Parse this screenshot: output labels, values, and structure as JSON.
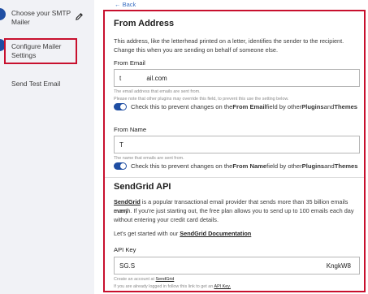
{
  "sidebar": {
    "steps": [
      {
        "label": "Choose your SMTP Mailer"
      },
      {
        "label": "Configure Mailer Settings"
      },
      {
        "label": "Send Test Email"
      }
    ]
  },
  "back_label": "← Back",
  "from_address": {
    "title": "From Address",
    "description": "This address, like the letterhead printed on a letter, identifies the sender to the recipient. Change this when you are sending on behalf of someone else.",
    "from_email_label": "From Email",
    "from_email_value": "t              ail.com",
    "from_email_help_1": "The email address that emails are sent from.",
    "from_email_help_2": "Please note that other plugins may override this field, to prevent this use the setting below.",
    "force_email_text": {
      "pre": "Check this to prevent changes on the ",
      "bold1": "From Email",
      "mid": " field by other ",
      "bold2": "Plugins",
      "and": " and ",
      "bold3": "Themes"
    },
    "from_name_label": "From Name",
    "from_name_value": "T",
    "from_name_help": "The name that emails are sent from.",
    "force_name_text": {
      "pre": "Check this to prevent changes on the ",
      "bold1": "From Name",
      "mid": " field by other ",
      "bold2": "Plugins",
      "and": " and ",
      "bold3": "Themes"
    }
  },
  "sendgrid": {
    "title": "SendGrid API",
    "desc_link": "SendGrid",
    "desc_rest_1": " is a popular transactional email provider that sends more than 35 billion emails every",
    "desc_line_2": "month. If you're just starting out, the free plan allows you to send up to 100 emails each day",
    "desc_line_3": "without entering your credit card details.",
    "docs_pre": "Let's get started with our ",
    "docs_link": "SendGrid Documentation",
    "api_key_label": "API Key",
    "api_key_start": "SG.S",
    "api_key_end": "KngkW8",
    "create_pre": "Create an account at ",
    "create_link": "SendGrid",
    "logged_in_pre": "If you are already logged in follow this link to get an ",
    "logged_in_link": "API Key."
  },
  "colors": {
    "accent": "#1f4ea3",
    "highlight": "#c8102e"
  }
}
